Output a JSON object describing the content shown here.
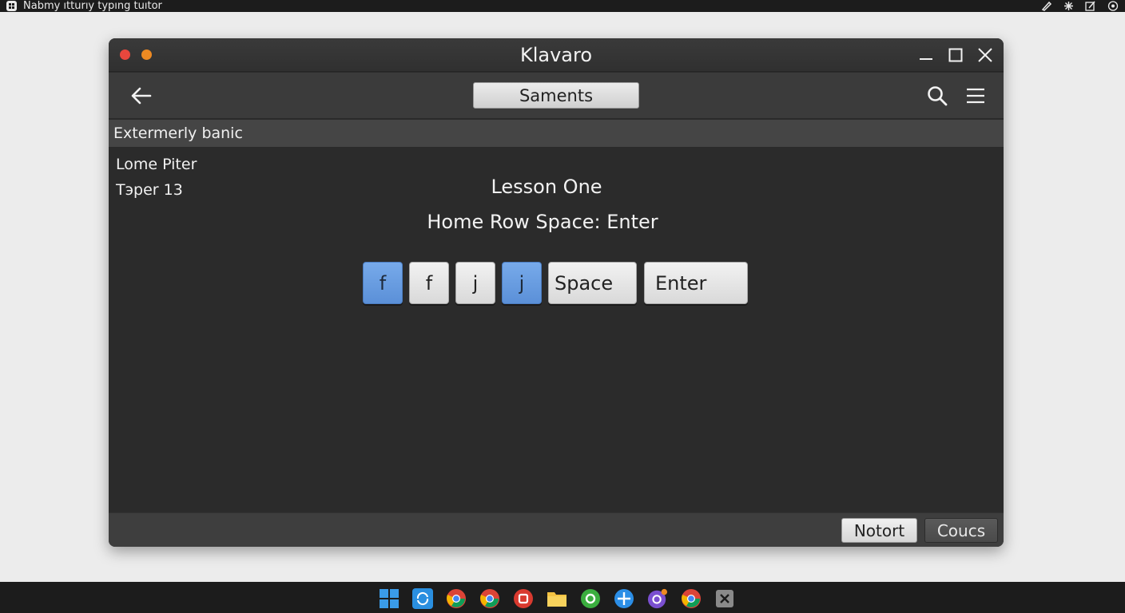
{
  "topbar": {
    "app_title": "Nabmy ıtturıy typıng tuıtor",
    "icons": [
      "app-icon",
      "pen-icon",
      "settings-icon",
      "edit-icon",
      "record-icon"
    ]
  },
  "window": {
    "title": "Klavaro",
    "controls": [
      "minimize-icon",
      "maximize-icon",
      "close-icon"
    ]
  },
  "toolbar": {
    "center_button": "Saments",
    "icons": [
      "back-arrow-icon",
      "search-icon",
      "hamburger-menu-icon"
    ]
  },
  "subbar": {
    "label": "Extermerly banic"
  },
  "content": {
    "side_line_1": "Lome Piter",
    "side_line_2": "Tэper 13",
    "lesson_title": "Lesson One",
    "lesson_subtitle": "Home Row Space: Enter",
    "keys": [
      {
        "label": "f",
        "highlighted": true
      },
      {
        "label": "f",
        "highlighted": false
      },
      {
        "label": "j",
        "highlighted": false
      },
      {
        "label": "j",
        "highlighted": true
      },
      {
        "label": "Space",
        "highlighted": false
      },
      {
        "label": "Enter",
        "highlighted": false
      }
    ]
  },
  "footer": {
    "button_primary": "Notort",
    "button_secondary": "Coucs"
  },
  "taskbar": {
    "apps": [
      "windows-start-icon",
      "refresh-app-icon",
      "chrome-icon",
      "chrome-icon",
      "red-app-icon",
      "file-explorer-icon",
      "green-app-icon",
      "blue-app-icon",
      "purple-app-icon",
      "chrome-icon",
      "security-app-icon"
    ]
  },
  "colors": {
    "key_highlight": "#6a9fe3",
    "window_bg": "#2b2b2b",
    "close_dot": "#e8473d",
    "min_dot": "#ee8a22"
  }
}
